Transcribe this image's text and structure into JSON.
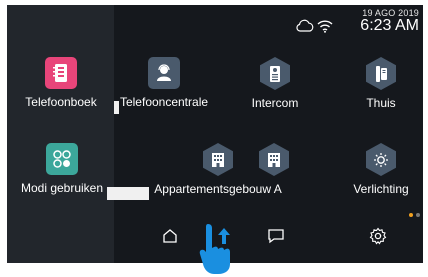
{
  "status": {
    "date": "19 AGO 2019",
    "time": "6:23 AM",
    "icons": [
      "cloud-icon",
      "wifi-icon"
    ]
  },
  "apps": [
    {
      "label": "Telefoonboek",
      "icon": "phonebook-icon"
    },
    {
      "label": "Telefooncentrale",
      "icon": "operator-icon"
    },
    {
      "label": "Intercom",
      "icon": "intercom-icon"
    },
    {
      "label": "Thuis",
      "icon": "handset-icon"
    },
    {
      "label": "Modi gebruiken",
      "icon": "modes-icon"
    },
    {
      "label": "Appartementsgebouw A",
      "icon": "building-icon"
    },
    {
      "label": "Verlichting",
      "icon": "light-icon"
    }
  ],
  "nav": [
    "home-icon",
    "swipe-up-arrow-icon",
    "message-icon",
    "settings-icon"
  ],
  "colors": {
    "accent": "#1a8fe0",
    "pink": "#e8457a",
    "teal": "#3ca79b",
    "dot_active": "#f0a020",
    "dot_inactive": "#777777"
  }
}
